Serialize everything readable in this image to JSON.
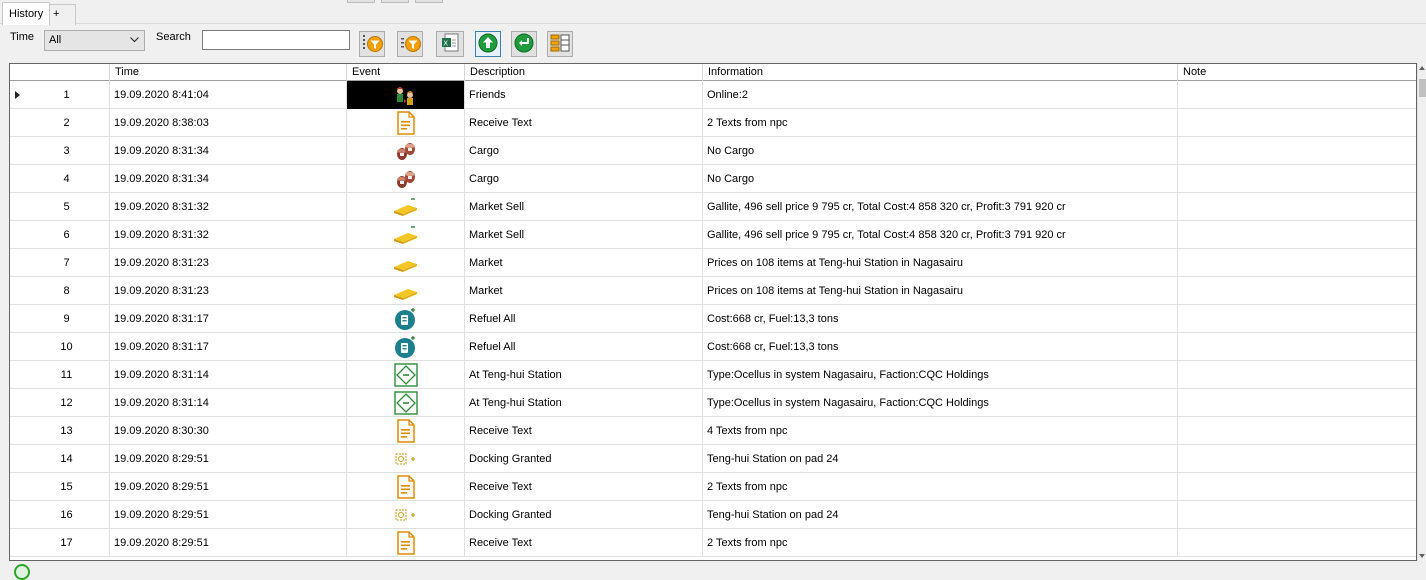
{
  "tabs": [
    {
      "label": "History"
    },
    {
      "label": "+"
    }
  ],
  "toolbar": {
    "time_label": "Time",
    "time_value": "All",
    "search_label": "Search",
    "search_value": "",
    "buttons": [
      "filter-event-icon",
      "filter-field-icon",
      "excel-export-icon",
      "move-top-icon",
      "refresh-icon",
      "column-layout-icon"
    ]
  },
  "columns": {
    "num": "",
    "time": "Time",
    "event": "Event",
    "description": "Description",
    "information": "Information",
    "note": "Note"
  },
  "rows": [
    {
      "n": "1",
      "time": "19.09.2020 8:41:04",
      "icon": "friends-icon",
      "description": "Friends",
      "information": "Online:2",
      "note": "",
      "selected": true
    },
    {
      "n": "2",
      "time": "19.09.2020 8:38:03",
      "icon": "document-icon",
      "description": "Receive Text",
      "information": "2 Texts from npc",
      "note": ""
    },
    {
      "n": "3",
      "time": "19.09.2020 8:31:34",
      "icon": "cargo-icon",
      "description": "Cargo",
      "information": "No Cargo",
      "note": ""
    },
    {
      "n": "4",
      "time": "19.09.2020 8:31:34",
      "icon": "cargo-icon",
      "description": "Cargo",
      "information": "No Cargo",
      "note": ""
    },
    {
      "n": "5",
      "time": "19.09.2020 8:31:32",
      "icon": "gold-bar-minus-icon",
      "description": "Market Sell",
      "information": "Gallite, 496 sell price 9 795 cr, Total Cost:4 858 320 cr, Profit:3 791 920 cr",
      "note": ""
    },
    {
      "n": "6",
      "time": "19.09.2020 8:31:32",
      "icon": "gold-bar-minus-icon",
      "description": "Market Sell",
      "information": "Gallite, 496 sell price 9 795 cr, Total Cost:4 858 320 cr, Profit:3 791 920 cr",
      "note": ""
    },
    {
      "n": "7",
      "time": "19.09.2020 8:31:23",
      "icon": "gold-bar-icon",
      "description": "Market",
      "information": "Prices on 108 items at Teng-hui Station in Nagasairu",
      "note": ""
    },
    {
      "n": "8",
      "time": "19.09.2020 8:31:23",
      "icon": "gold-bar-icon",
      "description": "Market",
      "information": "Prices on 108 items at Teng-hui Station in Nagasairu",
      "note": ""
    },
    {
      "n": "9",
      "time": "19.09.2020 8:31:17",
      "icon": "fuel-icon",
      "description": "Refuel All",
      "information": "Cost:668 cr, Fuel:13,3 tons",
      "note": ""
    },
    {
      "n": "10",
      "time": "19.09.2020 8:31:17",
      "icon": "fuel-icon",
      "description": "Refuel All",
      "information": "Cost:668 cr, Fuel:13,3 tons",
      "note": ""
    },
    {
      "n": "11",
      "time": "19.09.2020 8:31:14",
      "icon": "station-icon",
      "description": "At Teng-hui Station",
      "information": "Type:Ocellus in system Nagasairu, Faction:CQC Holdings",
      "note": ""
    },
    {
      "n": "12",
      "time": "19.09.2020 8:31:14",
      "icon": "station-icon",
      "description": "At Teng-hui Station",
      "information": "Type:Ocellus in system Nagasairu, Faction:CQC Holdings",
      "note": ""
    },
    {
      "n": "13",
      "time": "19.09.2020 8:30:30",
      "icon": "document-icon",
      "description": "Receive Text",
      "information": "4 Texts from npc",
      "note": ""
    },
    {
      "n": "14",
      "time": "19.09.2020 8:29:51",
      "icon": "docking-granted-icon",
      "description": "Docking Granted",
      "information": "Teng-hui Station on pad 24",
      "note": ""
    },
    {
      "n": "15",
      "time": "19.09.2020 8:29:51",
      "icon": "document-icon",
      "description": "Receive Text",
      "information": "2 Texts from npc",
      "note": ""
    },
    {
      "n": "16",
      "time": "19.09.2020 8:29:51",
      "icon": "docking-granted-icon",
      "description": "Docking Granted",
      "information": "Teng-hui Station on pad 24",
      "note": ""
    },
    {
      "n": "17",
      "time": "19.09.2020 8:29:51",
      "icon": "document-icon",
      "description": "Receive Text",
      "information": "2 Texts from npc",
      "note": ""
    }
  ]
}
